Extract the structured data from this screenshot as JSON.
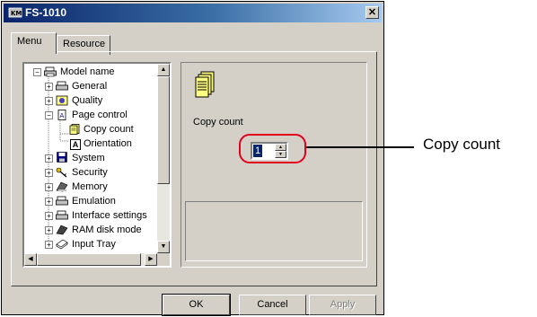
{
  "window": {
    "title": "FS-1010",
    "close_glyph": "✕"
  },
  "tabs": [
    {
      "label": "Menu",
      "active": true
    },
    {
      "label": "Resource",
      "active": false
    }
  ],
  "tree": {
    "items": [
      {
        "label": "Model name",
        "icon": "printer-icon",
        "expander": "−"
      },
      {
        "label": "General",
        "icon": "printer-icon",
        "expander": "+"
      },
      {
        "label": "Quality",
        "icon": "quality-icon",
        "expander": "+"
      },
      {
        "label": "Page control",
        "icon": "page-control-icon",
        "expander": "−"
      },
      {
        "label": "Copy count",
        "icon": "copy-document-icon",
        "expander": ""
      },
      {
        "label": "Orientation",
        "icon": "orientation-icon",
        "expander": ""
      },
      {
        "label": "System",
        "icon": "floppy-disk-icon",
        "expander": "+"
      },
      {
        "label": "Security",
        "icon": "key-icon",
        "expander": "+"
      },
      {
        "label": "Memory",
        "icon": "memory-icon",
        "expander": "+"
      },
      {
        "label": "Emulation",
        "icon": "printer-icon",
        "expander": "+"
      },
      {
        "label": "Interface settings",
        "icon": "printer-icon",
        "expander": "+"
      },
      {
        "label": "RAM disk mode",
        "icon": "ram-disk-icon",
        "expander": "+"
      },
      {
        "label": "Input Tray",
        "icon": "input-tray-icon",
        "expander": "+"
      }
    ],
    "orientation_glyph": "A"
  },
  "detail": {
    "icon": "copy-document-icon",
    "label": "Copy count",
    "value": "1"
  },
  "buttons": {
    "ok": "OK",
    "cancel": "Cancel",
    "apply": "Apply"
  },
  "callout": {
    "text": "Copy count",
    "color": "#e0001b"
  },
  "colors": {
    "face": "#d4d0c8",
    "title_start": "#0a246a",
    "title_end": "#a6caf0",
    "selection": "#0a246a"
  }
}
